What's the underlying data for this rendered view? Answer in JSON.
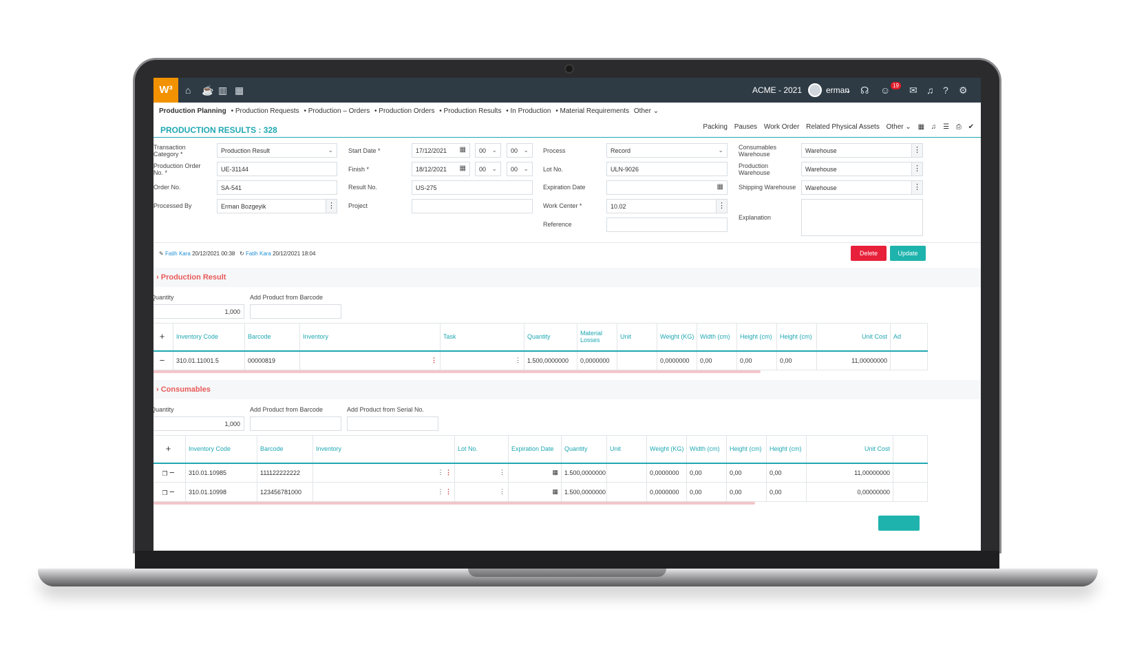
{
  "topbar": {
    "logo": "W³",
    "company": "ACME - 2021",
    "user": "erman",
    "notifications_count": "19"
  },
  "nav": {
    "items": [
      "Production Planning",
      "• Production Requests",
      "• Production – Orders",
      "• Production Orders",
      "• Production Results",
      "• In Production",
      "• Material Requirements",
      "Other ⌄"
    ]
  },
  "page": {
    "title": "PRODUCTION RESULTS : 328",
    "toolbar": [
      "Packing",
      "Pauses",
      "Work Order",
      "Related Physical Assets",
      "Other ⌄"
    ]
  },
  "form": {
    "transaction_category_label": "Transaction Category *",
    "transaction_category": "Production Result",
    "production_order_label": "Production Order No. *",
    "production_order": "UE-31144",
    "order_no_label": "Order No.",
    "order_no": "SA-541",
    "processed_by_label": "Processed By",
    "processed_by": "Erman Bozgeyik",
    "start_date_label": "Start Date *",
    "start_date": "17/12/2021",
    "start_hour": "00",
    "start_min": "00",
    "finish_label": "Finish *",
    "finish_date": "18/12/2021",
    "finish_hour": "00",
    "finish_min": "00",
    "result_no_label": "Result No.",
    "result_no": "US-275",
    "project_label": "Project",
    "project": "",
    "process_label": "Process",
    "process": "Record",
    "lot_no_label": "Lot No.",
    "lot_no": "ULN-9026",
    "expiration_date_label": "Expiration Date",
    "expiration_date": "",
    "work_center_label": "Work Center *",
    "work_center": "10.02",
    "reference_label": "Reference",
    "reference": "",
    "consumables_wh_label": "Consumables Warehouse",
    "consumables_wh": "Warehouse",
    "production_wh_label": "Production Warehouse",
    "production_wh": "Warehouse",
    "shipping_wh_label": "Shipping Warehouse",
    "shipping_wh": "Warehouse",
    "explanation_label": "Explanation",
    "explanation": ""
  },
  "audit": {
    "created_by": "Fatih Kara",
    "created_at": "20/12/2021 00:38",
    "updated_by": "Fatih Kara",
    "updated_at": "20/12/2021 18:04"
  },
  "actions": {
    "delete_label": "Delete",
    "update_label": "Update"
  },
  "production_result": {
    "title": "Production Result",
    "quantity_label": "Quantity",
    "quantity": "1,000",
    "barcode_label": "Add Product from Barcode",
    "barcode": "",
    "columns": [
      "Inventory Code",
      "Barcode",
      "Inventory",
      "Task",
      "Quantity",
      "Material Losses",
      "Unit",
      "Weight (KG)",
      "Width (cm)",
      "Height (cm)",
      "Height (cm)",
      "Unit Cost",
      "Ad"
    ],
    "rows": [
      {
        "inventory_code": "310.01.11001.5",
        "barcode": "00000819",
        "inventory": "",
        "task": "",
        "quantity": "1.500,0000000",
        "material_losses": "0,0000000",
        "unit": "",
        "weight": "0,0000000",
        "width": "0,00",
        "height1": "0,00",
        "height2": "0,00",
        "unit_cost": "11,00000000"
      }
    ]
  },
  "consumables": {
    "title": "Consumables",
    "quantity_label": "Quantity",
    "quantity": "1,000",
    "barcode_label": "Add Product from Barcode",
    "barcode": "",
    "serial_label": "Add Product from Serial No.",
    "serial": "",
    "columns": [
      "Inventory Code",
      "Barcode",
      "Inventory",
      "Lot No.",
      "Expiration Date",
      "Quantity",
      "Unit",
      "Weight (KG)",
      "Width (cm)",
      "Height (cm)",
      "Height (cm)",
      "Unit Cost"
    ],
    "rows": [
      {
        "inventory_code": "310.01.10985",
        "barcode": "111122222222",
        "inventory": "",
        "lot_no": "",
        "expiration_date": "",
        "quantity": "1.500,0000000",
        "unit": "",
        "weight": "0,0000000",
        "width": "0,00",
        "height1": "0,00",
        "height2": "0,00",
        "unit_cost": "11,00000000"
      },
      {
        "inventory_code": "310.01.10998",
        "barcode": "123456781000",
        "inventory": "",
        "lot_no": "",
        "expiration_date": "",
        "quantity": "1.500,0000000",
        "unit": "",
        "weight": "0,0000000",
        "width": "0,00",
        "height1": "0,00",
        "height2": "0,00",
        "unit_cost": "0,00000000"
      }
    ]
  }
}
